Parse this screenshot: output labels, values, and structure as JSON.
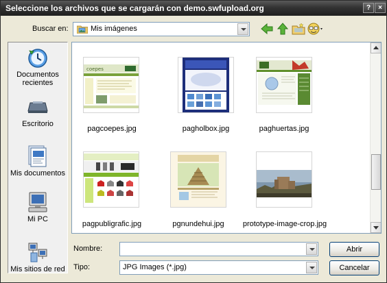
{
  "window": {
    "title": "Seleccione los archivos que se cargarán con demo.swfupload.org",
    "help_glyph": "?",
    "close_glyph": "×"
  },
  "lookin": {
    "label": "Buscar en:",
    "value": "Mis imágenes"
  },
  "toolbar": {
    "icons": [
      "back-icon",
      "up-folder-icon",
      "new-folder-icon",
      "view-menu-icon"
    ]
  },
  "places": [
    {
      "label": "Documentos recientes",
      "icon": "recent-documents-icon"
    },
    {
      "label": "Escritorio",
      "icon": "desktop-icon"
    },
    {
      "label": "Mis documentos",
      "icon": "my-documents-icon"
    },
    {
      "label": "Mi PC",
      "icon": "my-computer-icon"
    },
    {
      "label": "Mis sitios de red",
      "icon": "network-places-icon"
    }
  ],
  "files": [
    {
      "name": "pagcoepes.jpg"
    },
    {
      "name": "pagholbox.jpg"
    },
    {
      "name": "paghuertas.jpg"
    },
    {
      "name": "pagpubligrafic.jpg"
    },
    {
      "name": "pgnundehui.jpg"
    },
    {
      "name": "prototype-image-crop.jpg"
    }
  ],
  "filename": {
    "label": "Nombre:",
    "value": ""
  },
  "filetype": {
    "label": "Tipo:",
    "value": "JPG Images (*.jpg)"
  },
  "buttons": {
    "open": "Abrir",
    "cancel": "Cancelar"
  }
}
